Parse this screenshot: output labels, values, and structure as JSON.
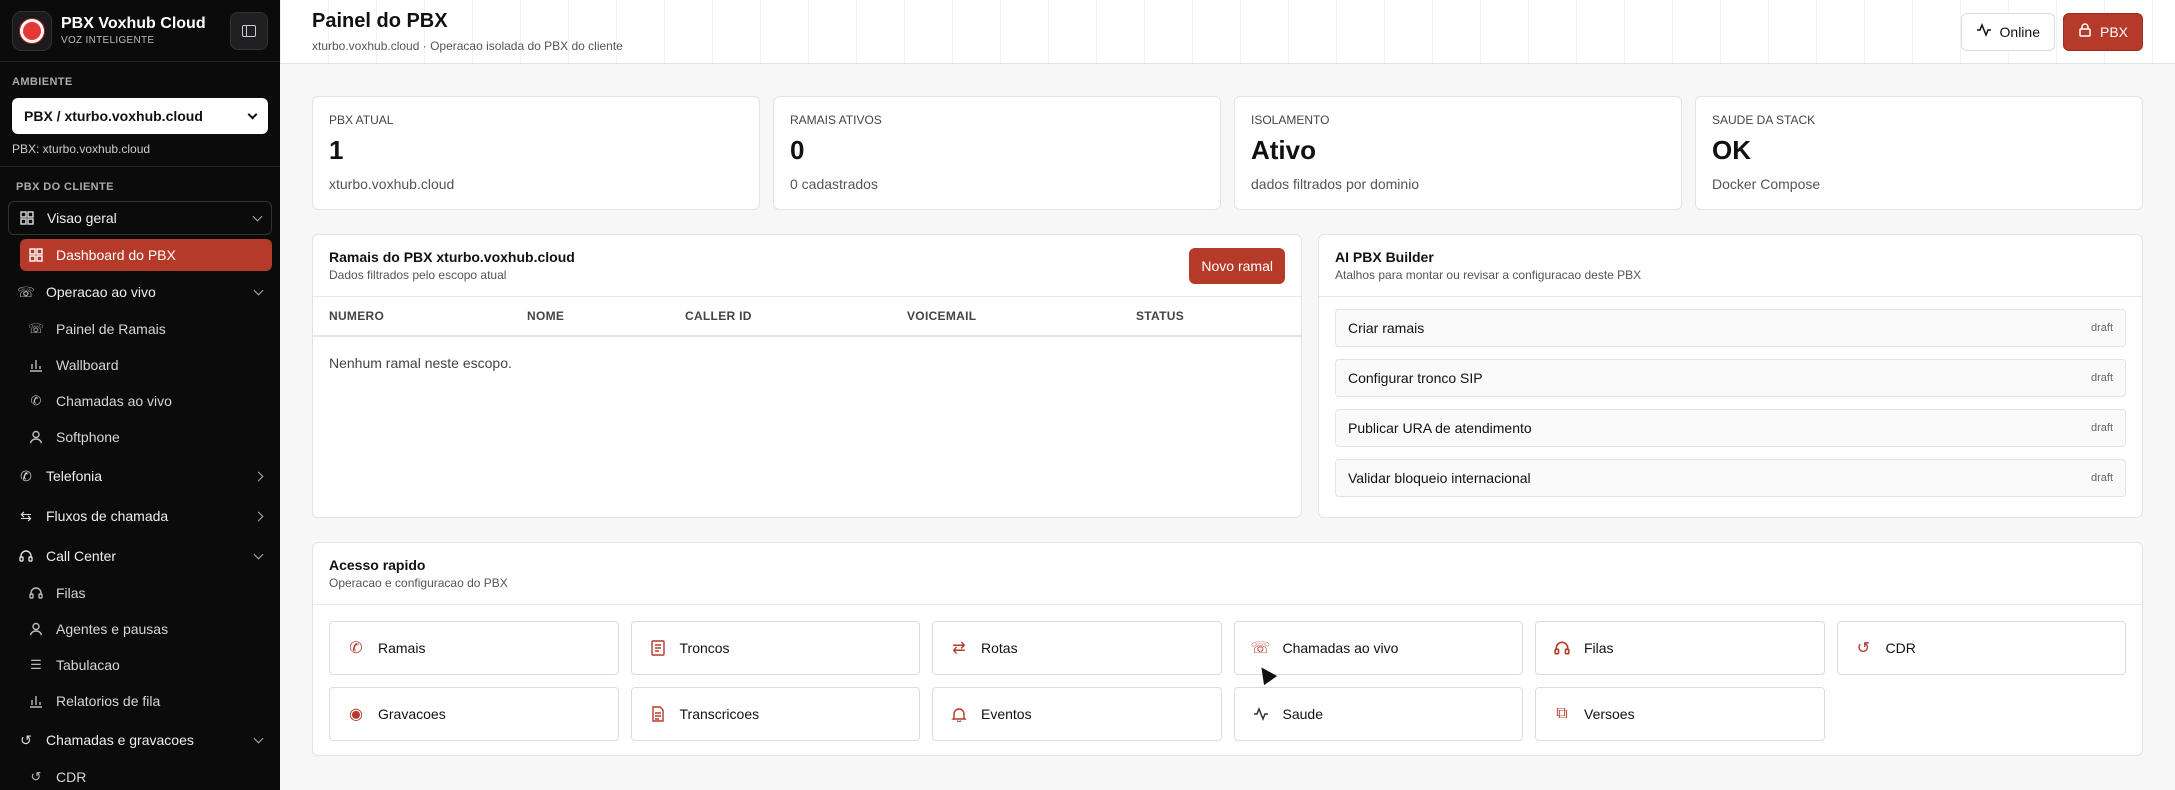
{
  "brand": {
    "title": "PBX Voxhub Cloud",
    "subtitle": "VOZ INTELIGENTE"
  },
  "environment": {
    "label": "AMBIENTE",
    "selected": "PBX / xturbo.voxhub.cloud",
    "current": "PBX: xturbo.voxhub.cloud"
  },
  "nav": {
    "section": "PBX DO CLIENTE",
    "visao_geral": "Visao geral",
    "dashboard": "Dashboard do PBX",
    "operacao": "Operacao ao vivo",
    "painel_ramais": "Painel de Ramais",
    "wallboard": "Wallboard",
    "chamadas_vivo": "Chamadas ao vivo",
    "softphone": "Softphone",
    "telefonia": "Telefonia",
    "fluxos": "Fluxos de chamada",
    "call_center": "Call Center",
    "filas": "Filas",
    "agentes": "Agentes e pausas",
    "tabulacao": "Tabulacao",
    "relatorios": "Relatorios de fila",
    "gravacoes_group": "Chamadas e gravacoes",
    "cdr": "CDR"
  },
  "header": {
    "title": "Painel do PBX",
    "subtitle": "xturbo.voxhub.cloud · Operacao isolada do PBX do cliente",
    "online": "Online",
    "pbx": "PBX"
  },
  "stats": [
    {
      "label": "PBX ATUAL",
      "value": "1",
      "sub": "xturbo.voxhub.cloud"
    },
    {
      "label": "RAMAIS ATIVOS",
      "value": "0",
      "sub": "0 cadastrados"
    },
    {
      "label": "ISOLAMENTO",
      "value": "Ativo",
      "sub": "dados filtrados por dominio"
    },
    {
      "label": "SAUDE DA STACK",
      "value": "OK",
      "sub": "Docker Compose"
    }
  ],
  "ramais": {
    "title": "Ramais do PBX xturbo.voxhub.cloud",
    "subtitle": "Dados filtrados pelo escopo atual",
    "new_button": "Novo ramal",
    "columns": [
      "NUMERO",
      "NOME",
      "CALLER ID",
      "VOICEMAIL",
      "STATUS"
    ],
    "empty": "Nenhum ramal neste escopo."
  },
  "ai": {
    "title": "AI PBX Builder",
    "subtitle": "Atalhos para montar ou revisar a configuracao deste PBX",
    "items": [
      {
        "label": "Criar ramais",
        "status": "draft"
      },
      {
        "label": "Configurar tronco SIP",
        "status": "draft"
      },
      {
        "label": "Publicar URA de atendimento",
        "status": "draft"
      },
      {
        "label": "Validar bloqueio internacional",
        "status": "draft"
      }
    ]
  },
  "quick": {
    "title": "Acesso rapido",
    "subtitle": "Operacao e configuracao do PBX",
    "items": [
      {
        "label": "Ramais",
        "icon": "phone-icon"
      },
      {
        "label": "Troncos",
        "icon": "trunk-icon"
      },
      {
        "label": "Rotas",
        "icon": "route-icon"
      },
      {
        "label": "Chamadas ao vivo",
        "icon": "live-call-icon"
      },
      {
        "label": "Filas",
        "icon": "headset-icon"
      },
      {
        "label": "CDR",
        "icon": "history-icon"
      },
      {
        "label": "Gravacoes",
        "icon": "recording-icon"
      },
      {
        "label": "Transcricoes",
        "icon": "document-icon"
      },
      {
        "label": "Eventos",
        "icon": "bell-icon"
      },
      {
        "label": "Saude",
        "icon": "pulse-icon"
      },
      {
        "label": "Versoes",
        "icon": "versions-icon"
      }
    ]
  }
}
